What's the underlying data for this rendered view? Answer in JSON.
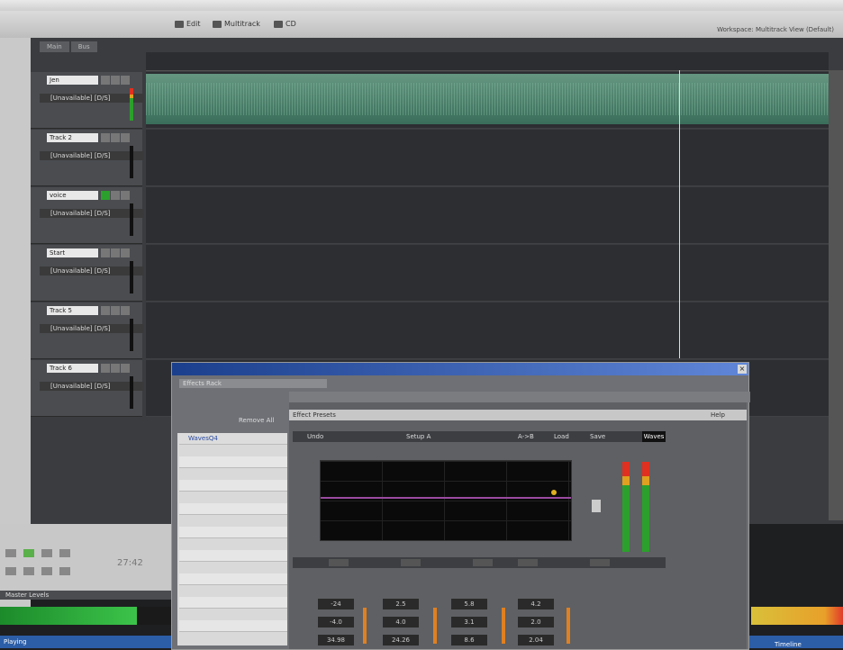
{
  "window": {
    "title": ""
  },
  "toolbar": {
    "buttons": [
      {
        "id": "edit",
        "label": "Edit"
      },
      {
        "id": "multitrack",
        "label": "Multitrack"
      },
      {
        "id": "cd",
        "label": "CD"
      }
    ],
    "workspace_label": "Workspace: Multitrack View (Default)"
  },
  "panel_tabs": [
    "Main",
    "Bus"
  ],
  "tracks": [
    {
      "name": "Jen",
      "input": "[Unavailable] [D/S]"
    },
    {
      "name": "Track 2",
      "input": "[Unavailable] [D/S]"
    },
    {
      "name": "voice",
      "input": "[Unavailable] [D/S]"
    },
    {
      "name": "Start",
      "input": "[Unavailable] [D/S]"
    },
    {
      "name": "Track 5",
      "input": "[Unavailable] [D/S]"
    },
    {
      "name": "Track 6",
      "input": "[Unavailable] [D/S]"
    }
  ],
  "transport": {
    "time": "27:42"
  },
  "master_levels_label": "Master Levels",
  "status_text": "Playing",
  "timeline_label": "Timeline",
  "rack": {
    "tab_label": "Effects Rack",
    "remove_all": "Remove All",
    "slots": [
      "WavesQ4",
      "",
      "",
      "",
      "",
      "",
      "",
      "",
      "",
      "",
      "",
      "",
      "",
      ""
    ]
  },
  "plugin": {
    "preset_label": "Effect Presets",
    "help": "Help",
    "waves_header": [
      "Undo",
      "Setup A",
      "A->B",
      "Load",
      "Save"
    ],
    "waves_logo": "Waves",
    "controls_row1": [
      "-24",
      "2.5",
      "5.8",
      "4.2"
    ],
    "controls_row2": [
      "-4.0",
      "4.0",
      "3.1",
      "2.0"
    ],
    "controls_row3": [
      "34.98",
      "24.26",
      "8.6",
      "2.04"
    ]
  },
  "colors": {
    "clip_green": "#5a9a80",
    "rack_title_blue": "#1b3f8c",
    "eq_curve": "#9a4aa0",
    "eq_node": "#e0b020",
    "meter_green": "#3cc44a",
    "meter_red": "#e03020"
  }
}
